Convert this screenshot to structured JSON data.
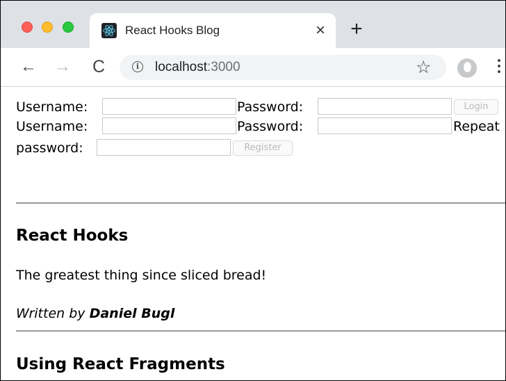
{
  "browser": {
    "tab_title": "React Hooks Blog",
    "tab_close": "×",
    "new_tab": "+",
    "url_host": "localhost",
    "url_port": ":3000",
    "back": "←",
    "forward": "→",
    "reload": "C",
    "star": "☆"
  },
  "login_form": {
    "username_label": "Username:",
    "password_label": "Password:",
    "button": "Login"
  },
  "register_form": {
    "username_label": "Username:",
    "password_label": "Password:",
    "repeat_label_part1": "Repeat",
    "repeat_label_part2": "password:",
    "button": "Register"
  },
  "posts": [
    {
      "title": "React Hooks",
      "content": "The greatest thing since sliced bread!",
      "written_by": "Written by",
      "author": "Daniel Bugl"
    },
    {
      "title": "Using React Fragments"
    }
  ]
}
